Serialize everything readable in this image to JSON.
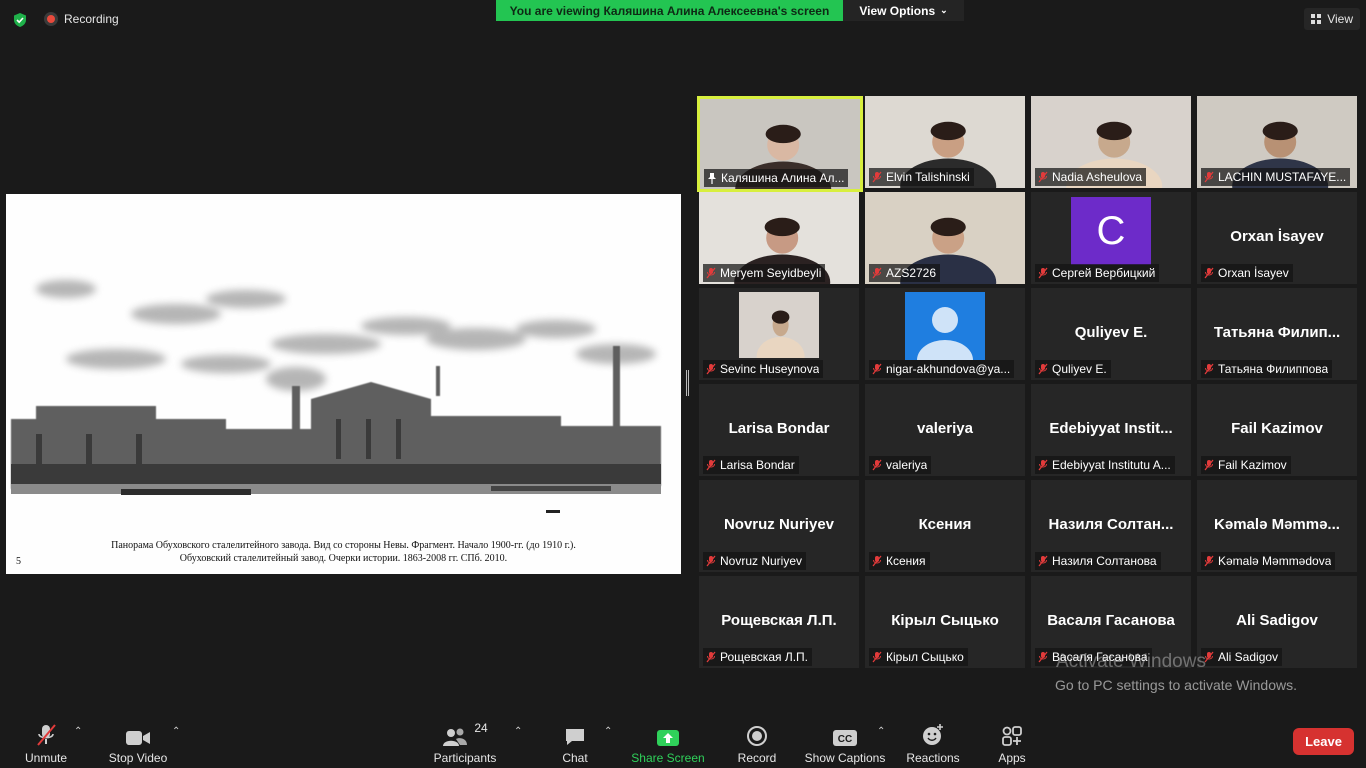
{
  "top": {
    "recording_label": "Recording",
    "banner": "You are viewing Каляшина Алина Алексеевна's screen",
    "view_options": "View Options",
    "view_label": "View"
  },
  "shared_screen": {
    "caption_line1": "Панорама Обуховского сталелитейного завода. Вид со стороны Невы. Фрагмент. Начало 1900-гг. (до 1910 г.).",
    "caption_line2": "Обуховский сталелитейный завод. Очерки истории. 1863-2008 гг. СПб. 2010.",
    "page_number": "5"
  },
  "participants": [
    {
      "label": "Каляшина Алина Ал...",
      "big": "",
      "kind": "video",
      "icon": "pin-icon",
      "active": true
    },
    {
      "label": "Elvin Talishinski",
      "big": "",
      "kind": "video",
      "icon": "mic-muted-icon"
    },
    {
      "label": "Nadia Asheulova",
      "big": "",
      "kind": "video",
      "icon": "mic-muted-icon"
    },
    {
      "label": "LACHIN MUSTAFAYE...",
      "big": "",
      "kind": "video",
      "icon": "mic-muted-icon"
    },
    {
      "label": "Meryem Seyidbeyli",
      "big": "",
      "kind": "video",
      "icon": "mic-muted-icon"
    },
    {
      "label": "AZS2726",
      "big": "",
      "kind": "video",
      "icon": "mic-muted-icon"
    },
    {
      "label": "Сергей Вербицкий",
      "big": "C",
      "kind": "avatar-letter",
      "icon": "mic-muted-icon"
    },
    {
      "label": "Orxan İsayev",
      "big": "Orxan İsayev",
      "kind": "name",
      "icon": "mic-muted-icon"
    },
    {
      "label": "Sevinc Huseynova",
      "big": "",
      "kind": "photo",
      "icon": "mic-muted-icon"
    },
    {
      "label": "nigar-akhundova@ya...",
      "big": "",
      "kind": "avatar-person",
      "icon": "mic-muted-icon"
    },
    {
      "label": "Quliyev E.",
      "big": "Quliyev E.",
      "kind": "name",
      "icon": "mic-muted-icon"
    },
    {
      "label": "Татьяна Филиппова",
      "big": "Татьяна  Филип...",
      "kind": "name",
      "icon": "mic-muted-icon"
    },
    {
      "label": "Larisa Bondar",
      "big": "Larisa Bondar",
      "kind": "name",
      "icon": "mic-muted-icon"
    },
    {
      "label": "valeriya",
      "big": "valeriya",
      "kind": "name",
      "icon": "mic-muted-icon"
    },
    {
      "label": "Edebiyyat Institutu A...",
      "big": "Edebiyyat  Instit...",
      "kind": "name",
      "icon": "mic-muted-icon"
    },
    {
      "label": "Fail Kazimov",
      "big": "Fail Kazimov",
      "kind": "name",
      "icon": "mic-muted-icon"
    },
    {
      "label": "Novruz Nuriyev",
      "big": "Novruz Nuriyev",
      "kind": "name",
      "icon": "mic-muted-icon"
    },
    {
      "label": "Ксения",
      "big": "Ксения",
      "kind": "name",
      "icon": "mic-muted-icon"
    },
    {
      "label": "Назиля Солтанова",
      "big": "Назиля  Солтан...",
      "kind": "name",
      "icon": "mic-muted-icon"
    },
    {
      "label": "Kəmalə Məmmədova",
      "big": "Kəmalə  Məmmə...",
      "kind": "name",
      "icon": "mic-muted-icon"
    },
    {
      "label": "Рощевская Л.П.",
      "big": "Рощевская Л.П.",
      "kind": "name",
      "icon": "mic-muted-icon"
    },
    {
      "label": "Кірыл Сыцько",
      "big": "Кірыл Сыцько",
      "kind": "name",
      "icon": "mic-muted-icon"
    },
    {
      "label": "Васаля Гасанова",
      "big": "Васаля Гасанова",
      "kind": "name",
      "icon": "mic-muted-icon"
    },
    {
      "label": "Ali Sadigov",
      "big": "Ali Sadigov",
      "kind": "name",
      "icon": "mic-muted-icon"
    }
  ],
  "watermark": {
    "line1": "Activate Windows",
    "line2": "Go to PC settings to activate Windows."
  },
  "toolbar": {
    "unmute": "Unmute",
    "stop_video": "Stop Video",
    "participants": "Participants",
    "participants_count": "24",
    "chat": "Chat",
    "share_screen": "Share Screen",
    "record": "Record",
    "show_captions": "Show Captions",
    "reactions": "Reactions",
    "apps": "Apps",
    "leave": "Leave"
  },
  "colors": {
    "banner": "#23c552",
    "active_speaker": "#d8ef3e",
    "leave": "#d63230",
    "share_green": "#2fd15a"
  }
}
